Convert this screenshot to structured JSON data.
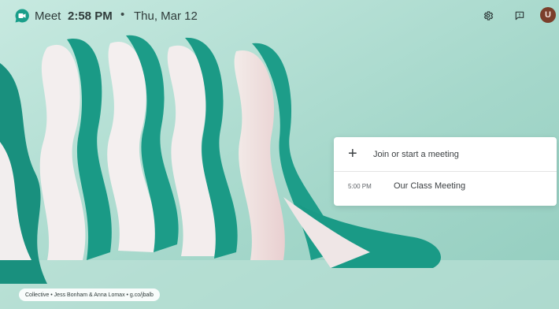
{
  "header": {
    "app_name": "Meet",
    "time": "2:58 PM",
    "separator": "•",
    "date": "Thu, Mar 12",
    "avatar_initial": "U"
  },
  "meeting_card": {
    "join_label": "Join or start a meeting",
    "meetings": [
      {
        "time": "5:00 PM",
        "title": "Our Class Meeting"
      }
    ]
  },
  "wallpaper_credit": "Collective • Jess Bonham & Anna Lomax • g.co/jbalb",
  "icons": [
    "meet-logo-icon",
    "settings-icon",
    "feedback-icon"
  ],
  "colors": {
    "background": "#a9d8cc",
    "teal": "#1b9b86",
    "card": "#ffffff",
    "avatar": "#7b3f2b"
  }
}
